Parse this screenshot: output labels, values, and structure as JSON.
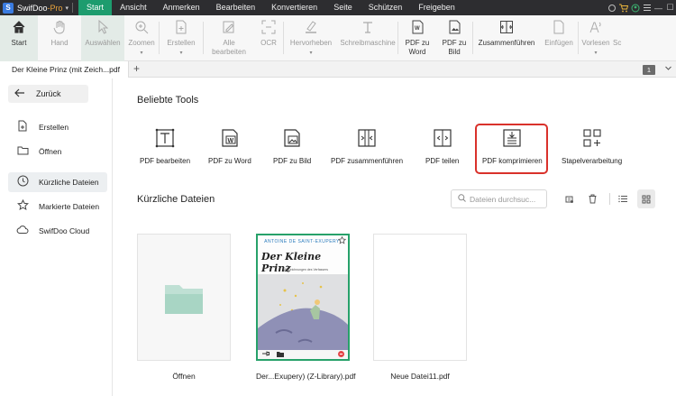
{
  "app": {
    "logo_letter": "S",
    "name": "SwifDoo",
    "edition": "-Pro",
    "dropdown_caret": "▾"
  },
  "menu": [
    "Start",
    "Ansicht",
    "Anmerken",
    "Bearbeiten",
    "Konvertieren",
    "Seite",
    "Schützen",
    "Freigeben"
  ],
  "window_controls": {
    "minimize": "—",
    "maximize": "☐",
    "close": "✕"
  },
  "ribbon": {
    "start": "Start",
    "hand": "Hand",
    "select": "Auswählen",
    "zoom": "Zoomen",
    "create": "Erstellen",
    "edit_all": "Alle bearbeiten",
    "ocr": "OCR",
    "highlight": "Hervorheben",
    "typewriter": "Schreibmaschine",
    "to_word": "PDF zu Word",
    "to_image": "PDF zu Bild",
    "merge": "Zusammenführen",
    "insert": "Einfügen",
    "read_aloud": "Vorlesen",
    "cut_off": "Sc"
  },
  "tabs": {
    "doc": "Der Kleine Prinz (mit Zeich...pdf",
    "add": "+",
    "page_count": "1"
  },
  "sidebar": {
    "back": "Zurück",
    "items": [
      "Erstellen",
      "Öffnen",
      "Kürzliche Dateien",
      "Markierte Dateien",
      "SwifDoo Cloud"
    ]
  },
  "popular_tools": {
    "title": "Beliebte Tools",
    "items": [
      "PDF bearbeiten",
      "PDF zu Word",
      "PDF zu Bild",
      "PDF zusammenführen",
      "PDF teilen",
      "PDF komprimieren",
      "Stapelverarbeitung"
    ]
  },
  "recent": {
    "title": "Kürzliche Dateien",
    "search_placeholder": "Dateien durchsuc...",
    "files": [
      "Öffnen",
      "Der...Exupery) (Z-Library).pdf",
      "Neue Datei11.pdf"
    ]
  },
  "cover": {
    "author": "ANTOINE DE SAINT-EXUPERY",
    "title": "Der Kleine Prinz",
    "subtitle": "Mit Zeichnungen des Verfassers"
  },
  "colors": {
    "accent": "#1d9c6e",
    "highlight_border": "#d9312b",
    "folder": "#bfe0d4"
  },
  "icons": [
    "home-icon",
    "hand-icon",
    "cursor-icon",
    "zoom-icon",
    "create-icon",
    "edit-icon",
    "ocr-icon",
    "highlighter-icon",
    "typewriter-icon",
    "word-icon",
    "image-icon",
    "merge-icon",
    "insert-icon",
    "read-aloud-icon"
  ]
}
